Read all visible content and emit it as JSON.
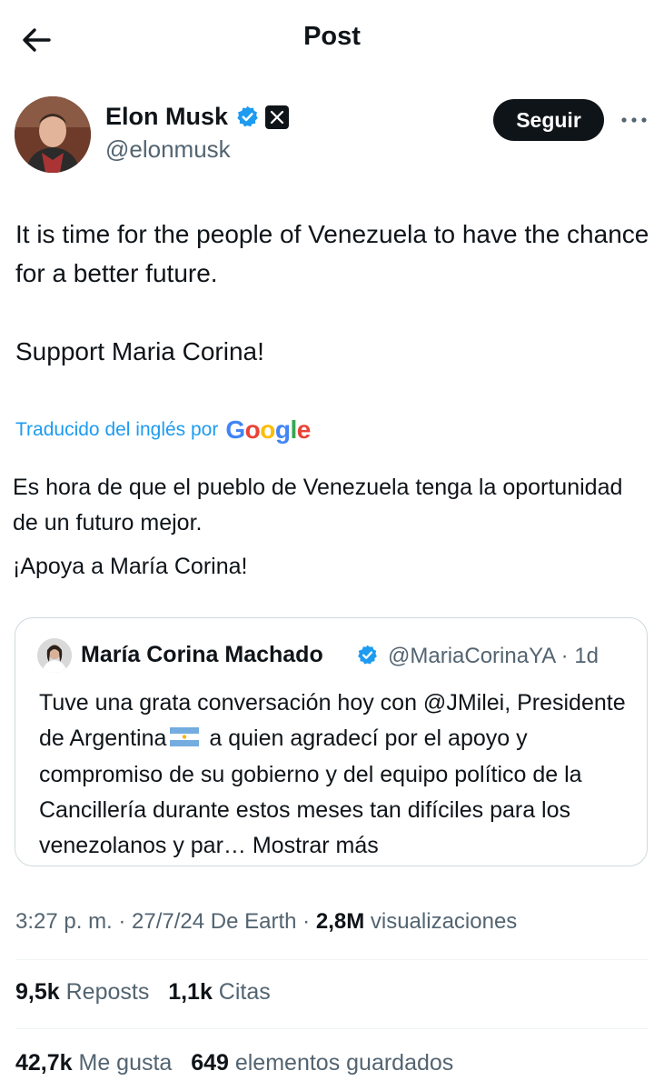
{
  "header": {
    "title": "Post"
  },
  "author": {
    "name": "Elon Musk",
    "handle": "@elonmusk",
    "follow_label": "Seguir"
  },
  "tweet": {
    "paragraphs": [
      "It is time for the people of Venezuela to have the chance for a better future.",
      "Support Maria Corina!"
    ],
    "translated_label": "Traducido del inglés por",
    "translation": [
      "Es hora de que el pueblo de Venezuela tenga la oportunidad de un futuro mejor.",
      "¡Apoya a María Corina!"
    ]
  },
  "quote": {
    "name": "María Corina Machado",
    "handle_time": "@MariaCorinaYA · 1d",
    "text_before_flag": "Tuve una grata conversación hoy con @JMilei, Presidente de Argentina",
    "text_after_flag": " a quien agradecí por el apoyo y compromiso de su gobierno y del equipo político de la Cancillería durante estos meses tan difíciles para los venezolanos y par…",
    "show_more": "Mostrar más"
  },
  "meta": {
    "time_date": "3:27 p. m. · 27/7/24 De Earth · ",
    "views_count": "2,8M",
    "views_label": " visualizaciones"
  },
  "stats": {
    "reposts_count": "9,5k",
    "reposts_label": " Reposts",
    "quotes_count": "1,1k",
    "quotes_label": " Citas",
    "likes_count": "42,7k",
    "likes_label": " Me gusta",
    "bookmarks_count": "649",
    "bookmarks_label": " elementos guardados"
  },
  "colors": {
    "accent": "#1d9bf0",
    "text": "#0f1419",
    "secondary": "#536471",
    "border": "#cfd9de"
  }
}
